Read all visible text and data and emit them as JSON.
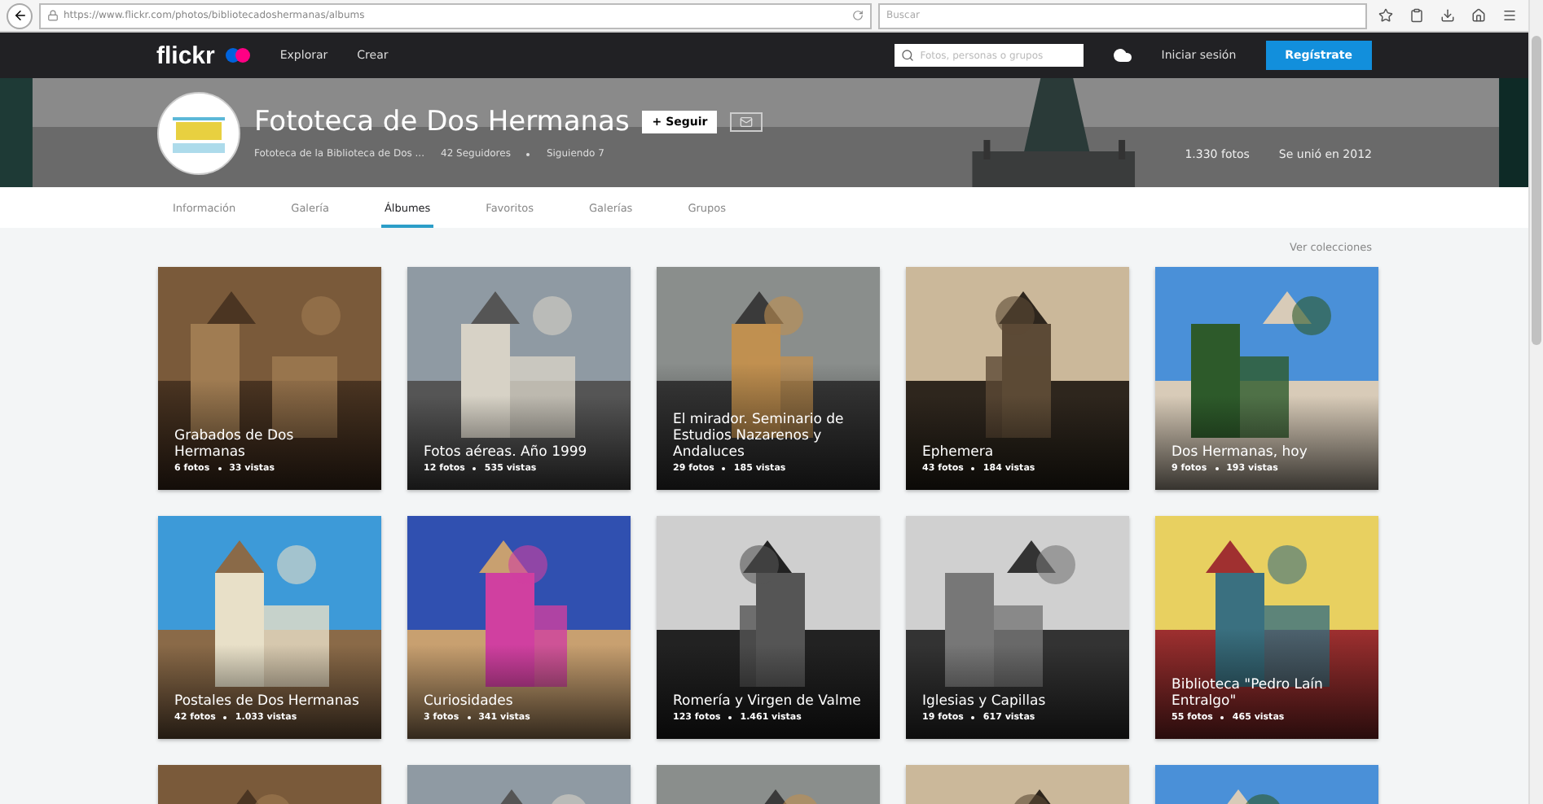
{
  "browser": {
    "url": "https://www.flickr.com/photos/bibliotecadoshermanas/albums",
    "search_placeholder": "Buscar"
  },
  "nav": {
    "logo": "flickr",
    "links": [
      "Explorar",
      "Crear"
    ],
    "search_placeholder": "Fotos, personas o grupos",
    "sign_in": "Iniciar sesión",
    "sign_up": "Regístrate"
  },
  "profile": {
    "name": "Fototeca de Dos Hermanas",
    "follow": "+ Seguir",
    "description": "Fototeca de la Biblioteca de Dos ...",
    "followers": "42 Seguidores",
    "following": "Siguiendo 7",
    "photos": "1.330 fotos",
    "joined": "Se unió en 2012"
  },
  "tabs": [
    {
      "label": "Información",
      "selected": false
    },
    {
      "label": "Galería",
      "selected": false
    },
    {
      "label": "Álbumes",
      "selected": true
    },
    {
      "label": "Favoritos",
      "selected": false
    },
    {
      "label": "Galerías",
      "selected": false
    },
    {
      "label": "Grupos",
      "selected": false
    }
  ],
  "collections_link": "Ver colecciones",
  "albums": [
    {
      "kind": "album",
      "title": "Grabados de Dos Hermanas",
      "photos": "6 fotos",
      "views": "33 vistas"
    },
    {
      "kind": "album",
      "title": "Fotos aéreas. Año 1999",
      "photos": "12 fotos",
      "views": "535 vistas"
    },
    {
      "kind": "album",
      "title": "El mirador. Seminario de Estudios Nazarenos y Andaluces",
      "photos": "29 fotos",
      "views": "185 vistas"
    },
    {
      "kind": "album",
      "title": "Ephemera",
      "photos": "43 fotos",
      "views": "184 vistas"
    },
    {
      "kind": "album",
      "title": "Dos Hermanas, hoy",
      "photos": "9 fotos",
      "views": "193 vistas"
    },
    {
      "kind": "album",
      "title": "Postales de Dos Hermanas",
      "photos": "42 fotos",
      "views": "1.033 vistas"
    },
    {
      "kind": "album",
      "title": "Curiosidades",
      "photos": "3 fotos",
      "views": "341 vistas"
    },
    {
      "kind": "album",
      "title": "Romería y Virgen de Valme",
      "photos": "123 fotos",
      "views": "1.461 vistas"
    },
    {
      "kind": "album",
      "title": "Iglesias y Capillas",
      "photos": "19 fotos",
      "views": "617 vistas"
    },
    {
      "kind": "album",
      "title": "Biblioteca \"Pedro Laín Entralgo\"",
      "photos": "55 fotos",
      "views": "465 vistas"
    },
    {
      "kind": "picture"
    },
    {
      "kind": "picture"
    },
    {
      "kind": "picture"
    },
    {
      "kind": "picture"
    },
    {
      "kind": "picture"
    }
  ]
}
